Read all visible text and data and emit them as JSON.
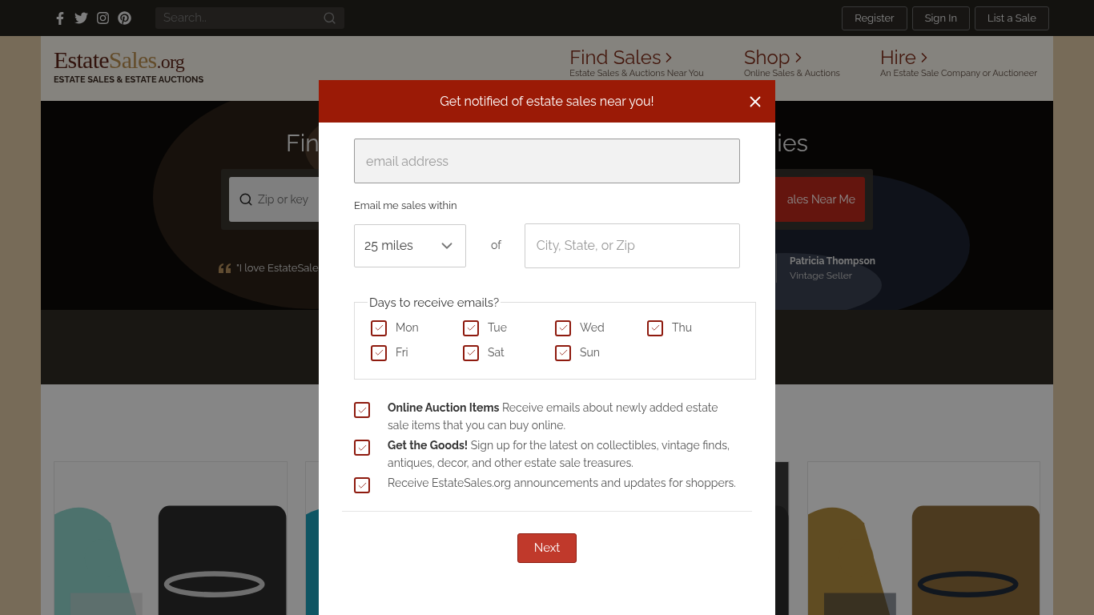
{
  "top_bar": {
    "search_placeholder": "Search..",
    "buttons": [
      "Register",
      "Sign In",
      "List a Sale"
    ]
  },
  "header": {
    "logo_parts": [
      "Estate",
      "Sales",
      ".org"
    ],
    "tagline": "ESTATE SALES & ESTATE AUCTIONS",
    "nav": [
      {
        "title": "Find Sales",
        "subtitle": "Estate Sales & Auctions Near You"
      },
      {
        "title": "Shop",
        "subtitle": "Online Sales & Auctions"
      },
      {
        "title": "Hire",
        "subtitle": "An Estate Sale Company or Auctioneer"
      }
    ]
  },
  "hero": {
    "title_left": "Fin",
    "title_right": "ies",
    "search_placeholder": "Zip or key",
    "button": "ales Near Me",
    "quote": "\"I love EstateSale",
    "author": "Patricia Thompson",
    "role": "Vintage Seller"
  },
  "modal": {
    "title": "Get notified of estate sales near you!",
    "email_placeholder": "email address",
    "within_label": "Email me sales within",
    "distance": "25 miles",
    "of": "of",
    "city_placeholder": "City, State, or Zip",
    "days_legend": "Days to receive emails?",
    "days": [
      {
        "label": "Mon",
        "checked": true
      },
      {
        "label": "Tue",
        "checked": true
      },
      {
        "label": "Wed",
        "checked": true
      },
      {
        "label": "Thu",
        "checked": true
      },
      {
        "label": "Fri",
        "checked": true
      },
      {
        "label": "Sat",
        "checked": true
      },
      {
        "label": "Sun",
        "checked": true
      }
    ],
    "options": [
      {
        "text": "**Online Auction Items** Receive emails about newly added estate sale items that you can buy online.",
        "checked": true
      },
      {
        "text": "**Get the Goods!** Sign up for the latest on collectibles, vintage finds, antiques, decor, and other estate sale treasures.",
        "checked": true
      },
      {
        "text": "Receive EstateSales.org announcements and updates for shoppers.",
        "checked": true
      }
    ],
    "next": "Next"
  }
}
